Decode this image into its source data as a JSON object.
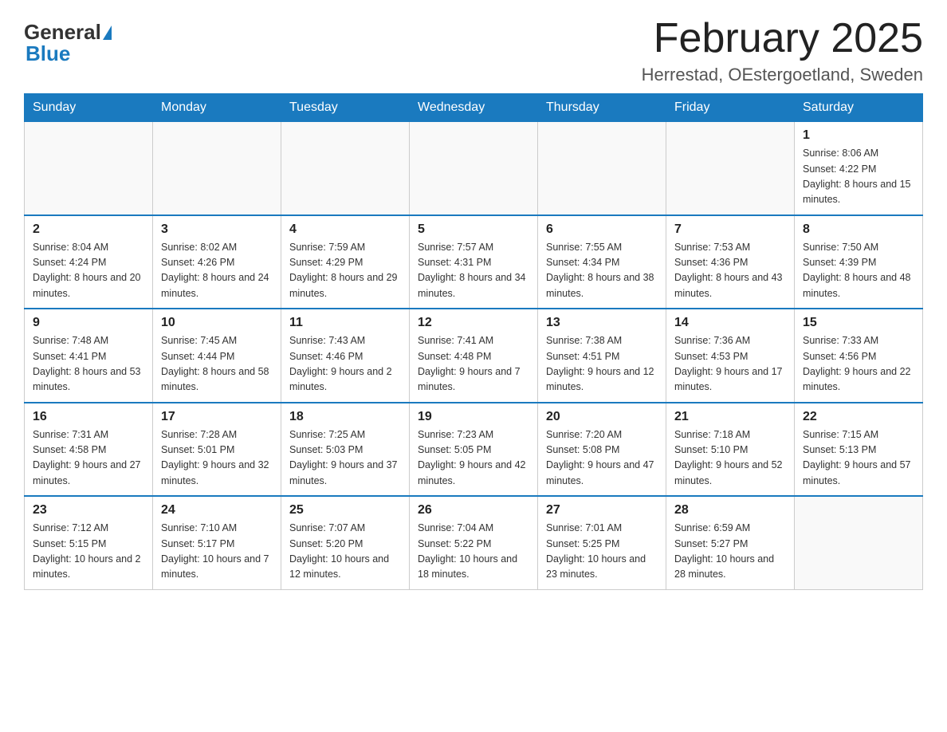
{
  "header": {
    "logo": {
      "general": "General",
      "blue": "Blue",
      "arrow": "▲"
    },
    "title": "February 2025",
    "subtitle": "Herrestad, OEstergoetland, Sweden"
  },
  "days_of_week": [
    "Sunday",
    "Monday",
    "Tuesday",
    "Wednesday",
    "Thursday",
    "Friday",
    "Saturday"
  ],
  "weeks": [
    {
      "days": [
        {
          "num": "",
          "info": ""
        },
        {
          "num": "",
          "info": ""
        },
        {
          "num": "",
          "info": ""
        },
        {
          "num": "",
          "info": ""
        },
        {
          "num": "",
          "info": ""
        },
        {
          "num": "",
          "info": ""
        },
        {
          "num": "1",
          "info": "Sunrise: 8:06 AM\nSunset: 4:22 PM\nDaylight: 8 hours and 15 minutes."
        }
      ]
    },
    {
      "days": [
        {
          "num": "2",
          "info": "Sunrise: 8:04 AM\nSunset: 4:24 PM\nDaylight: 8 hours and 20 minutes."
        },
        {
          "num": "3",
          "info": "Sunrise: 8:02 AM\nSunset: 4:26 PM\nDaylight: 8 hours and 24 minutes."
        },
        {
          "num": "4",
          "info": "Sunrise: 7:59 AM\nSunset: 4:29 PM\nDaylight: 8 hours and 29 minutes."
        },
        {
          "num": "5",
          "info": "Sunrise: 7:57 AM\nSunset: 4:31 PM\nDaylight: 8 hours and 34 minutes."
        },
        {
          "num": "6",
          "info": "Sunrise: 7:55 AM\nSunset: 4:34 PM\nDaylight: 8 hours and 38 minutes."
        },
        {
          "num": "7",
          "info": "Sunrise: 7:53 AM\nSunset: 4:36 PM\nDaylight: 8 hours and 43 minutes."
        },
        {
          "num": "8",
          "info": "Sunrise: 7:50 AM\nSunset: 4:39 PM\nDaylight: 8 hours and 48 minutes."
        }
      ]
    },
    {
      "days": [
        {
          "num": "9",
          "info": "Sunrise: 7:48 AM\nSunset: 4:41 PM\nDaylight: 8 hours and 53 minutes."
        },
        {
          "num": "10",
          "info": "Sunrise: 7:45 AM\nSunset: 4:44 PM\nDaylight: 8 hours and 58 minutes."
        },
        {
          "num": "11",
          "info": "Sunrise: 7:43 AM\nSunset: 4:46 PM\nDaylight: 9 hours and 2 minutes."
        },
        {
          "num": "12",
          "info": "Sunrise: 7:41 AM\nSunset: 4:48 PM\nDaylight: 9 hours and 7 minutes."
        },
        {
          "num": "13",
          "info": "Sunrise: 7:38 AM\nSunset: 4:51 PM\nDaylight: 9 hours and 12 minutes."
        },
        {
          "num": "14",
          "info": "Sunrise: 7:36 AM\nSunset: 4:53 PM\nDaylight: 9 hours and 17 minutes."
        },
        {
          "num": "15",
          "info": "Sunrise: 7:33 AM\nSunset: 4:56 PM\nDaylight: 9 hours and 22 minutes."
        }
      ]
    },
    {
      "days": [
        {
          "num": "16",
          "info": "Sunrise: 7:31 AM\nSunset: 4:58 PM\nDaylight: 9 hours and 27 minutes."
        },
        {
          "num": "17",
          "info": "Sunrise: 7:28 AM\nSunset: 5:01 PM\nDaylight: 9 hours and 32 minutes."
        },
        {
          "num": "18",
          "info": "Sunrise: 7:25 AM\nSunset: 5:03 PM\nDaylight: 9 hours and 37 minutes."
        },
        {
          "num": "19",
          "info": "Sunrise: 7:23 AM\nSunset: 5:05 PM\nDaylight: 9 hours and 42 minutes."
        },
        {
          "num": "20",
          "info": "Sunrise: 7:20 AM\nSunset: 5:08 PM\nDaylight: 9 hours and 47 minutes."
        },
        {
          "num": "21",
          "info": "Sunrise: 7:18 AM\nSunset: 5:10 PM\nDaylight: 9 hours and 52 minutes."
        },
        {
          "num": "22",
          "info": "Sunrise: 7:15 AM\nSunset: 5:13 PM\nDaylight: 9 hours and 57 minutes."
        }
      ]
    },
    {
      "days": [
        {
          "num": "23",
          "info": "Sunrise: 7:12 AM\nSunset: 5:15 PM\nDaylight: 10 hours and 2 minutes."
        },
        {
          "num": "24",
          "info": "Sunrise: 7:10 AM\nSunset: 5:17 PM\nDaylight: 10 hours and 7 minutes."
        },
        {
          "num": "25",
          "info": "Sunrise: 7:07 AM\nSunset: 5:20 PM\nDaylight: 10 hours and 12 minutes."
        },
        {
          "num": "26",
          "info": "Sunrise: 7:04 AM\nSunset: 5:22 PM\nDaylight: 10 hours and 18 minutes."
        },
        {
          "num": "27",
          "info": "Sunrise: 7:01 AM\nSunset: 5:25 PM\nDaylight: 10 hours and 23 minutes."
        },
        {
          "num": "28",
          "info": "Sunrise: 6:59 AM\nSunset: 5:27 PM\nDaylight: 10 hours and 28 minutes."
        },
        {
          "num": "",
          "info": ""
        }
      ]
    }
  ]
}
